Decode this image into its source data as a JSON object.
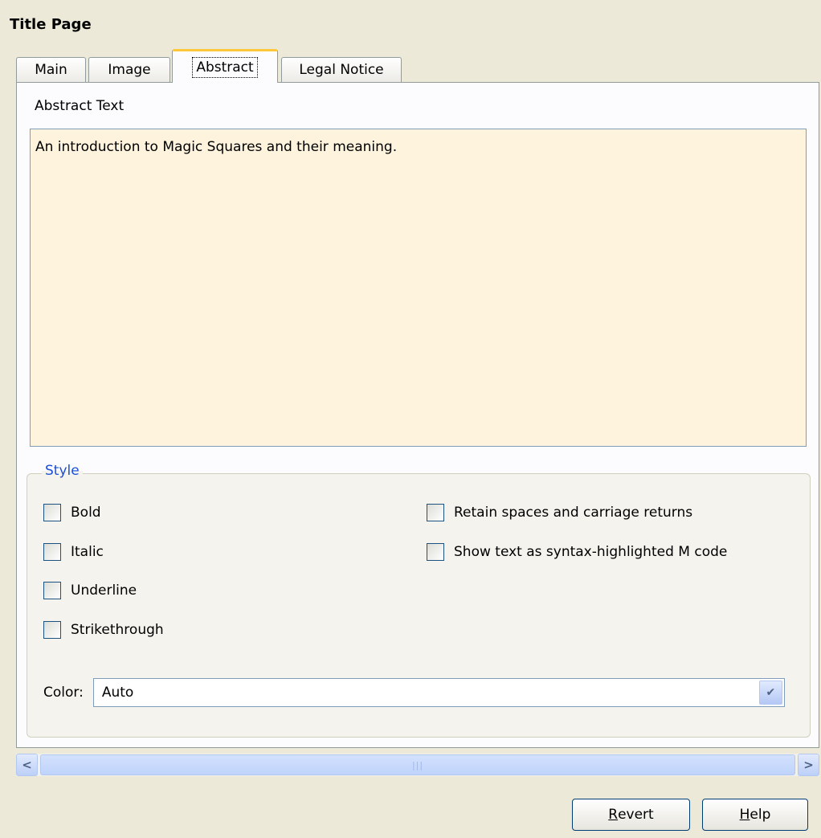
{
  "title": "Title Page",
  "tabs": [
    {
      "label": "Main"
    },
    {
      "label": "Image"
    },
    {
      "label": "Abstract"
    },
    {
      "label": "Legal Notice"
    }
  ],
  "active_tab": "Abstract",
  "abstract": {
    "label": "Abstract Text",
    "value": "An introduction to Magic Squares and their meaning."
  },
  "style": {
    "legend": "Style",
    "left_options": [
      {
        "label": "Bold",
        "checked": false
      },
      {
        "label": "Italic",
        "checked": false
      },
      {
        "label": "Underline",
        "checked": false
      },
      {
        "label": "Strikethrough",
        "checked": false
      }
    ],
    "right_options": [
      {
        "label": "Retain spaces and carriage returns",
        "checked": false
      },
      {
        "label": "Show text as syntax-highlighted M code",
        "checked": false
      }
    ],
    "color_label": "Color:",
    "color_value": "Auto"
  },
  "buttons": {
    "revert_mnemonic": "R",
    "revert_rest": "evert",
    "help_mnemonic": "H",
    "help_rest": "elp"
  },
  "colors": {
    "window_bg": "#ece9d8",
    "text_area_bg": "#fef3dd",
    "legend_color": "#1b4fd8",
    "active_tab_accent": "#ffc83c"
  }
}
